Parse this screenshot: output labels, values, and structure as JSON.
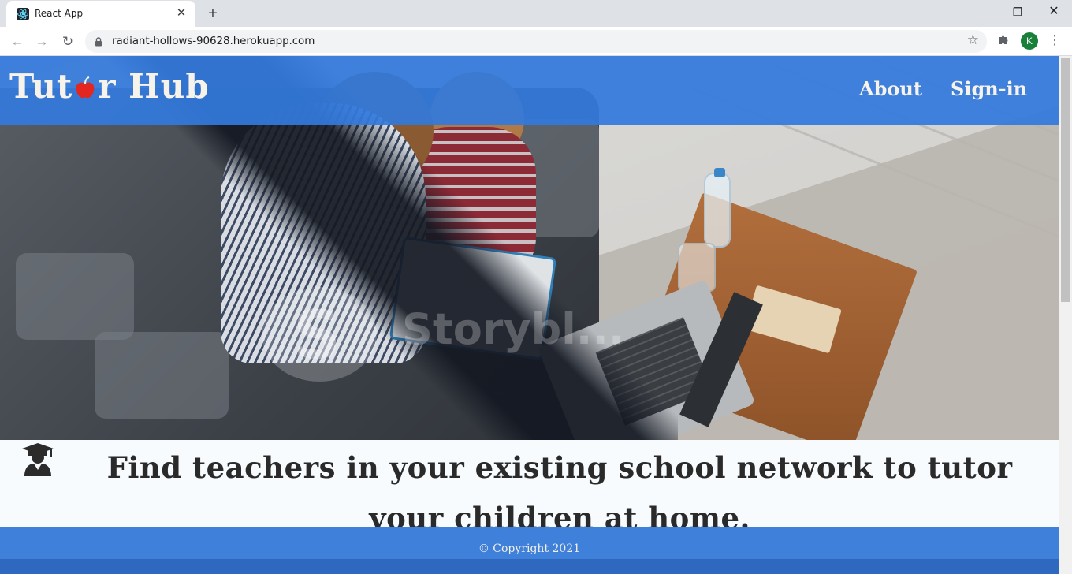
{
  "browser": {
    "tab_title": "React App",
    "tab_close": "✕",
    "new_tab": "+",
    "url": "radiant-hollows-90628.herokuapp.com",
    "avatar_letter": "K",
    "window_controls": {
      "minimize": "—",
      "maximize": "❐",
      "close": "✕"
    }
  },
  "site": {
    "logo_left": "Tut",
    "logo_right": "r Hub",
    "nav": {
      "about": "About",
      "signin": "Sign-in"
    },
    "tagline": "Find teachers in your existing school network to tutor your children at home.",
    "footer": {
      "copyright": "© Copyright 2021"
    },
    "hero_watermark": {
      "mark": "S",
      "text": "Storybl..."
    }
  },
  "colors": {
    "header_blue": "#337adc",
    "footer_blue": "#3e80da",
    "apple_red": "#e3261f",
    "tagline_bg": "#f7fbfd"
  },
  "icons": {
    "tab_favicon": "react-logo-icon",
    "lock": "lock-icon",
    "bookmark": "star-icon",
    "extensions": "puzzle-icon",
    "menu": "kebab-menu-icon",
    "tagline": "graduate-user-icon"
  }
}
